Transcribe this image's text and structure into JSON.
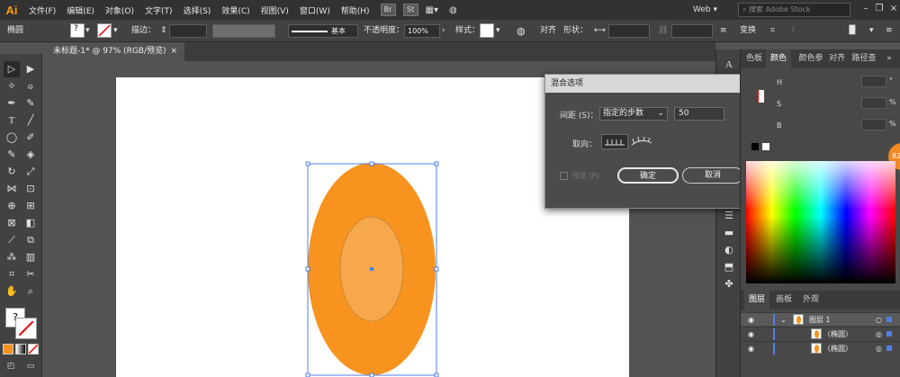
{
  "app": {
    "logo": "Ai",
    "menu": [
      "文件(F)",
      "编辑(E)",
      "对象(O)",
      "文字(T)",
      "选择(S)",
      "效果(C)",
      "视图(V)",
      "窗口(W)",
      "帮助(H)"
    ],
    "badges": [
      "Br",
      "St"
    ],
    "workspace": "Web",
    "stock_placeholder": "搜索 Adobe Stock"
  },
  "control_bar": {
    "object_type": "椭圆",
    "stroke_label": "描边：",
    "stroke_profile": "基本",
    "opacity_label": "不透明度：",
    "opacity_value": "100%",
    "style_label": "样式：",
    "align_label": "对齐",
    "shape_label": "形状：",
    "transform_label": "变换"
  },
  "document": {
    "tab_title": "未标题-1* @ 97% (RGB/预览)",
    "close": "×"
  },
  "colors": {
    "outer_ellipse": "#f7931e",
    "inner_ellipse": "#f7a84a",
    "selection": "#4f7fe8"
  },
  "blend_dialog": {
    "title": "混合选项",
    "spacing_label": "间距 (S)：",
    "spacing_mode": "指定的步数",
    "steps_value": "50",
    "orientation_label": "取向：",
    "preview_label": "预览 (P)",
    "ok_label": "确定",
    "cancel_label": "取消"
  },
  "color_panel": {
    "tabs": [
      "色板",
      "颜色",
      "颜色参",
      "对齐",
      "路径查"
    ],
    "h_label": "H",
    "s_label": "S",
    "b_label": "B",
    "percent": "%",
    "degree": "°",
    "extra_badge": "82"
  },
  "layers_panel": {
    "tabs": [
      "图层",
      "画板",
      "外观"
    ],
    "rows": [
      {
        "name": "图层 1"
      },
      {
        "name": "〈椭圆〉"
      },
      {
        "name": "〈椭圆〉"
      }
    ]
  }
}
